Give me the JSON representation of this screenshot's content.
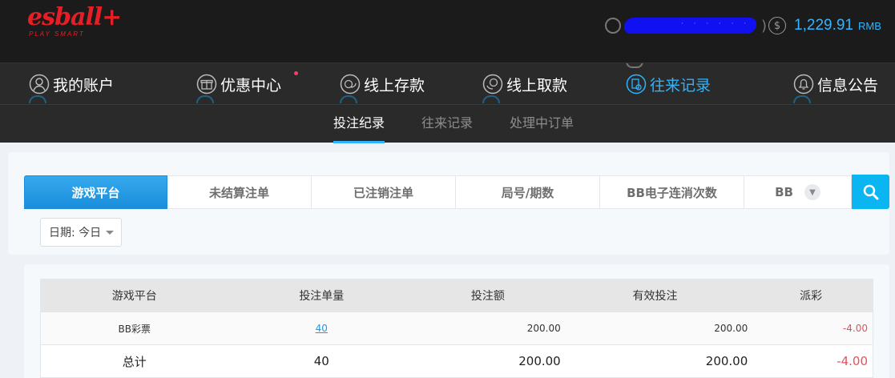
{
  "brand": {
    "logo_word": "esball+",
    "logo_tagline": "PLAY SMART"
  },
  "account": {
    "username": "· · · · · ·",
    "balance": "1,229.91",
    "currency": "RMB"
  },
  "nav": [
    {
      "label": "我的账户",
      "icon": "user-icon"
    },
    {
      "label": "优惠中心",
      "icon": "gift-icon"
    },
    {
      "label": "线上存款",
      "icon": "deposit-icon"
    },
    {
      "label": "线上取款",
      "icon": "withdraw-icon"
    },
    {
      "label": "往来记录",
      "icon": "records-icon",
      "active": true
    },
    {
      "label": "信息公告",
      "icon": "bell-icon"
    }
  ],
  "subnav": [
    {
      "label": "投注纪录",
      "active": true
    },
    {
      "label": "往来记录"
    },
    {
      "label": "处理中订单"
    }
  ],
  "filter_tabs": [
    {
      "label": "游戏平台",
      "active": true
    },
    {
      "label": "未结算注单"
    },
    {
      "label": "已注销注单"
    },
    {
      "label": "局号/期数"
    },
    {
      "label": "BB电子连消次数"
    },
    {
      "label": "BB"
    }
  ],
  "date_filter": {
    "label": "日期: 今日"
  },
  "table": {
    "columns": [
      "游戏平台",
      "投注单量",
      "投注额",
      "有效投注",
      "派彩"
    ],
    "rows": [
      {
        "platform": "BB彩票",
        "count": "40",
        "amount": "200.00",
        "valid": "200.00",
        "payout": "-4.00"
      }
    ],
    "total": {
      "label": "总计",
      "count": "40",
      "amount": "200.00",
      "valid": "200.00",
      "payout": "-4.00"
    }
  },
  "colors": {
    "accent": "#2db3ff",
    "brand": "#e61e25",
    "negative": "#e8505b",
    "search": "#0ab5f2"
  }
}
